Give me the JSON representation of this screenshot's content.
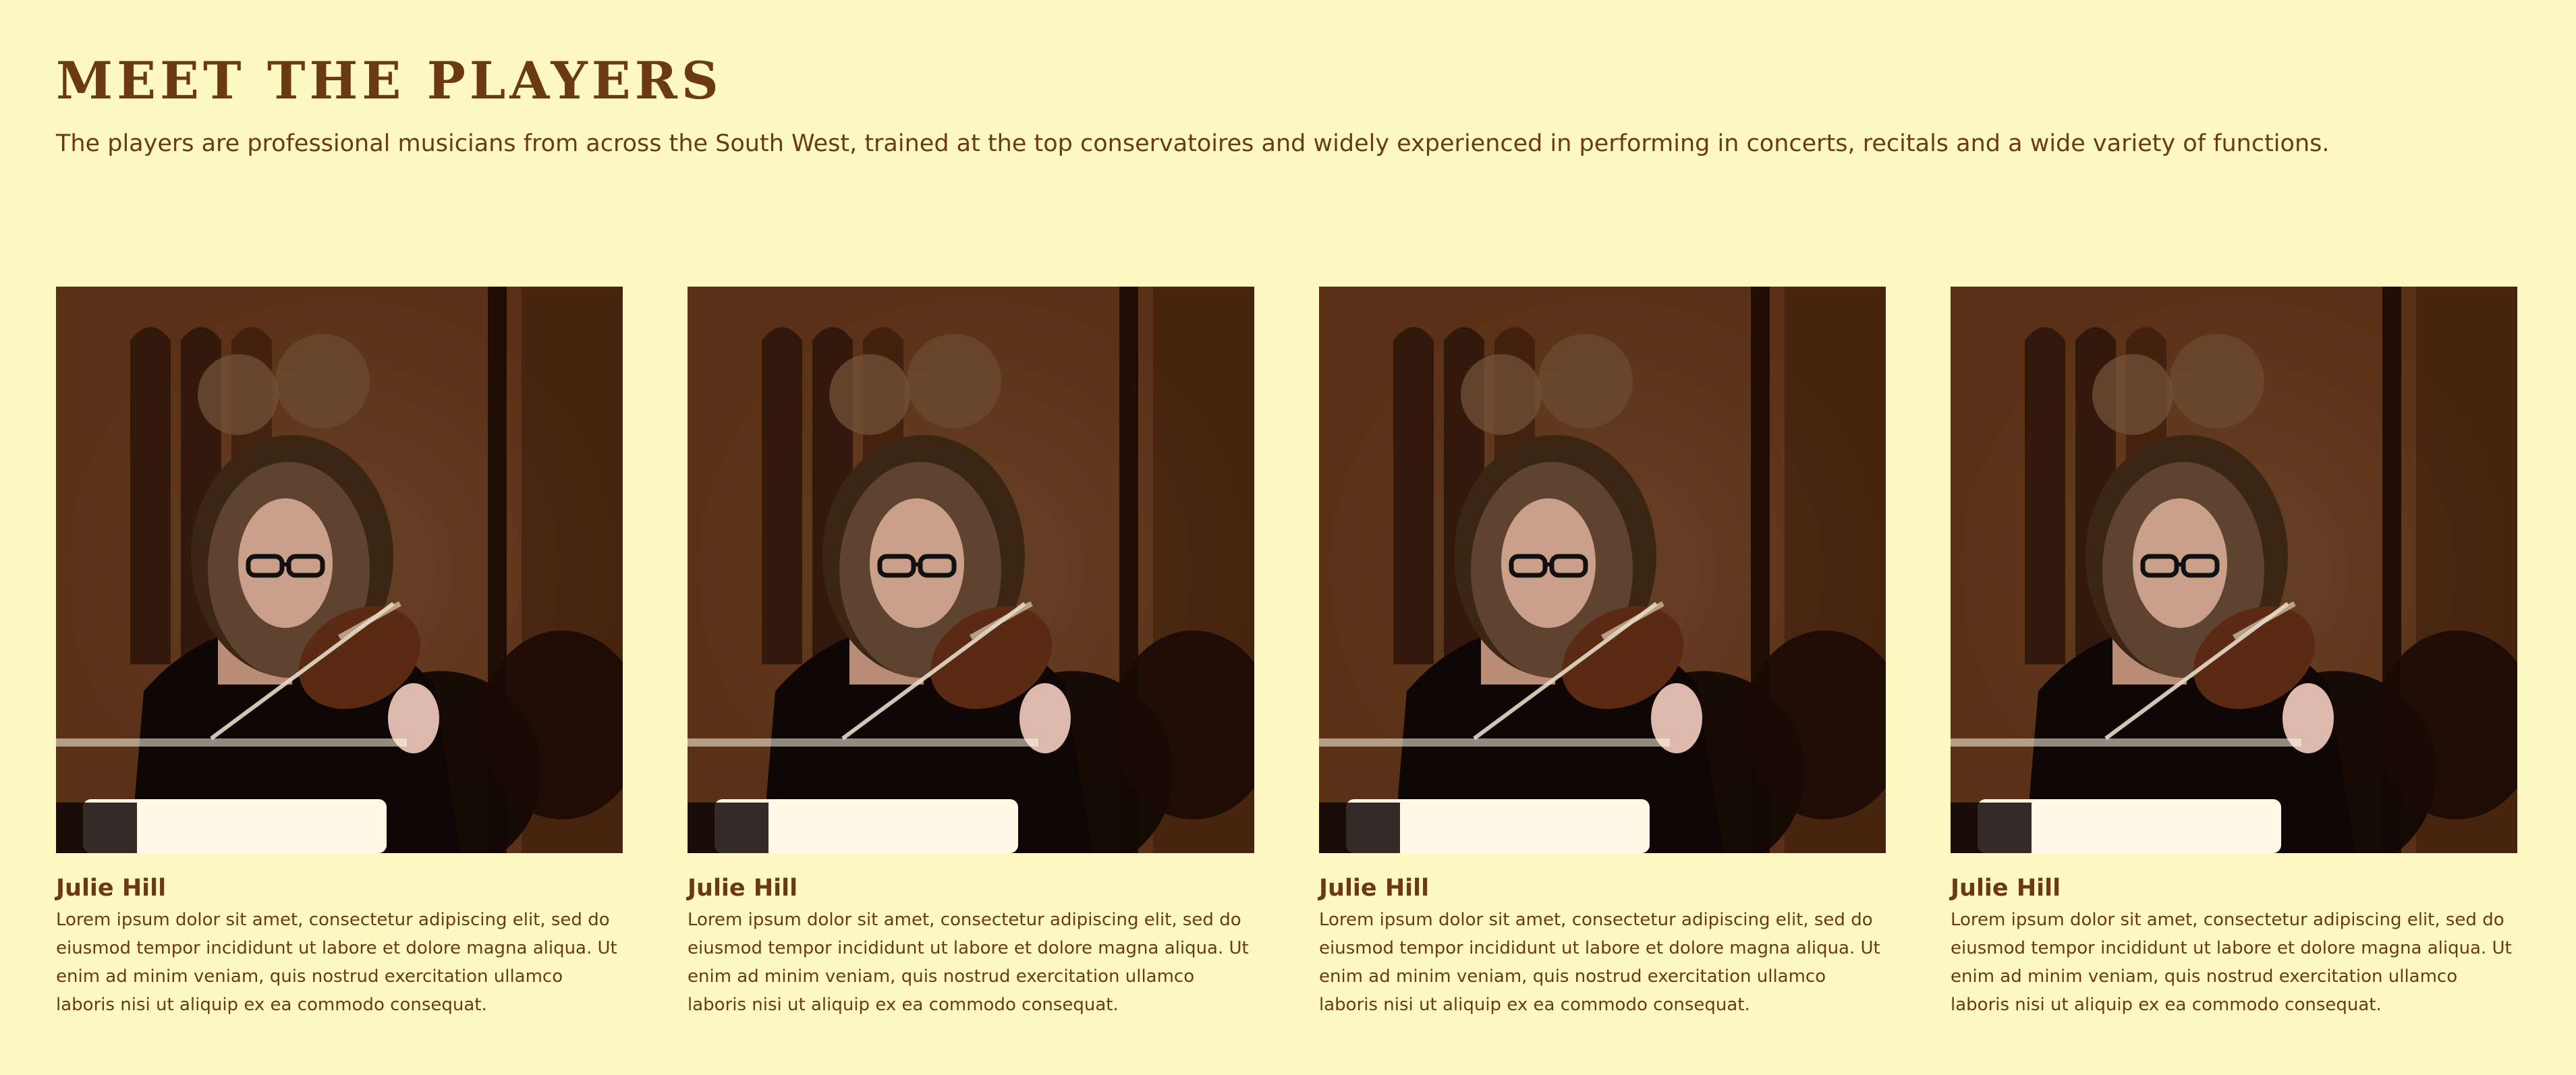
{
  "section": {
    "title": "MEET THE PLAYERS",
    "intro": "The players are professional musicians from across the South West, trained at the top conservatoires and widely experienced in performing in concerts, recitals and a wide variety of functions."
  },
  "players": [
    {
      "name": "Julie Hill",
      "bio": "Lorem ipsum dolor sit amet, consectetur adipiscing elit, sed do eiusmod tempor incididunt ut labore et dolore magna aliqua. Ut enim ad minim veniam, quis nostrud exercitation ullamco laboris nisi ut aliquip ex ea commodo consequat."
    },
    {
      "name": "Julie Hill",
      "bio": "Lorem ipsum dolor sit amet, consectetur adipiscing elit, sed do eiusmod tempor incididunt ut labore et dolore magna aliqua. Ut enim ad minim veniam, quis nostrud exercitation ullamco laboris nisi ut aliquip ex ea commodo consequat."
    },
    {
      "name": "Julie Hill",
      "bio": "Lorem ipsum dolor sit amet, consectetur adipiscing elit, sed do eiusmod tempor incididunt ut labore et dolore magna aliqua. Ut enim ad minim veniam, quis nostrud exercitation ullamco laboris nisi ut aliquip ex ea commodo consequat."
    },
    {
      "name": "Julie Hill",
      "bio": "Lorem ipsum dolor sit amet, consectetur adipiscing elit, sed do eiusmod tempor incididunt ut labore et dolore magna aliqua. Ut enim ad minim veniam, quis nostrud exercitation ullamco laboris nisi ut aliquip ex ea commodo consequat."
    }
  ],
  "colors": {
    "background": "#fef9c3",
    "text": "#6b3a10"
  }
}
